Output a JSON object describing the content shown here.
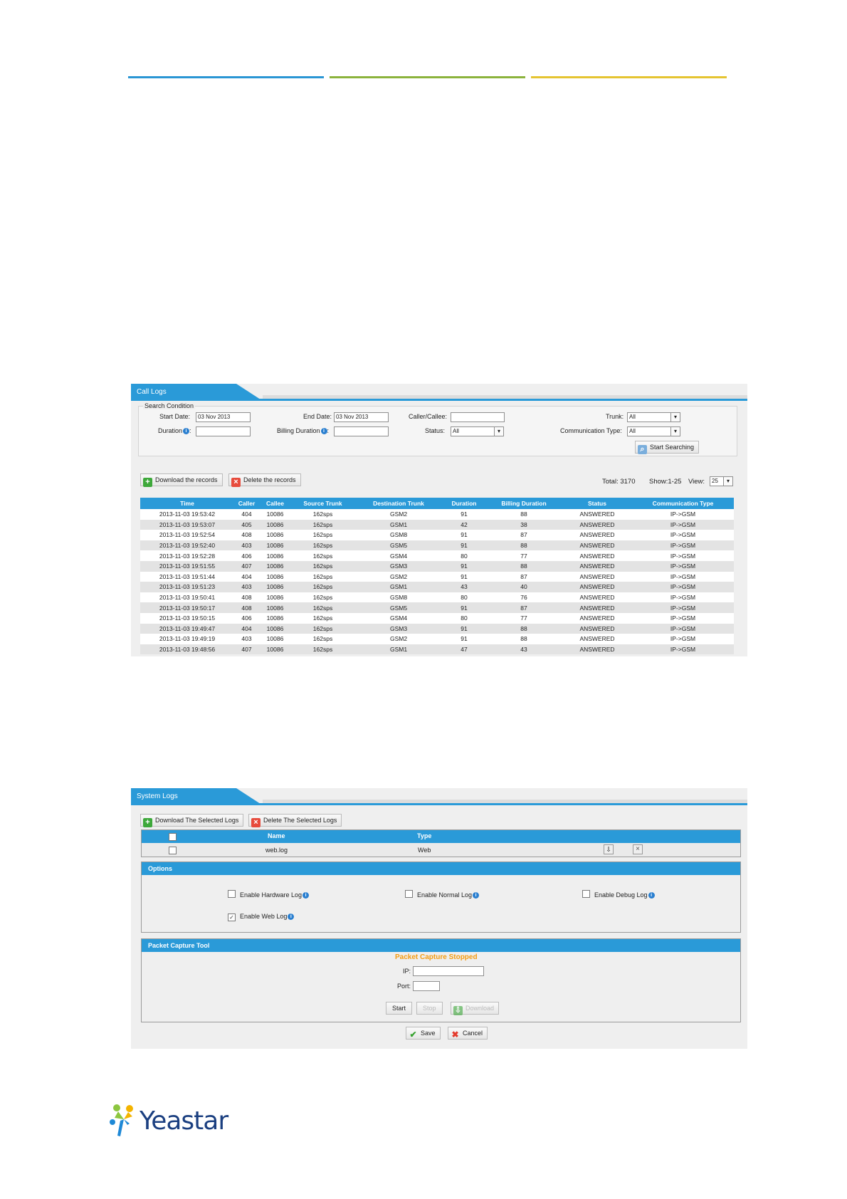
{
  "call_logs": {
    "title": "Call Logs",
    "search": {
      "legend": "Search Condition",
      "start_date_label": "Start Date:",
      "start_date_value": "03 Nov 2013",
      "end_date_label": "End Date:",
      "end_date_value": "03 Nov 2013",
      "caller_callee_label": "Caller/Callee:",
      "caller_callee_value": "",
      "trunk_label": "Trunk:",
      "trunk_value": "All",
      "duration_label": "Duration",
      "duration_value": "",
      "billing_duration_label": "Billing Duration",
      "billing_duration_value": "",
      "status_label": "Status:",
      "status_value": "All",
      "comm_type_label": "Communication Type:",
      "comm_type_value": "All",
      "start_button": "Start Searching"
    },
    "toolbar": {
      "download_label": "Download the records",
      "delete_label": "Delete the records",
      "total": "Total: 3170",
      "show": "Show:1-25",
      "view_label": "View:",
      "view_value": "25"
    },
    "columns": [
      "Time",
      "Caller",
      "Callee",
      "Source Trunk",
      "Destination Trunk",
      "Duration",
      "Billing Duration",
      "Status",
      "Communication Type"
    ],
    "rows": [
      [
        "2013-11-03 19:53:42",
        "404",
        "10086",
        "162sps",
        "GSM2",
        "91",
        "88",
        "ANSWERED",
        "IP->GSM"
      ],
      [
        "2013-11-03 19:53:07",
        "405",
        "10086",
        "162sps",
        "GSM1",
        "42",
        "38",
        "ANSWERED",
        "IP->GSM"
      ],
      [
        "2013-11-03 19:52:54",
        "408",
        "10086",
        "162sps",
        "GSM8",
        "91",
        "87",
        "ANSWERED",
        "IP->GSM"
      ],
      [
        "2013-11-03 19:52:40",
        "403",
        "10086",
        "162sps",
        "GSM5",
        "91",
        "88",
        "ANSWERED",
        "IP->GSM"
      ],
      [
        "2013-11-03 19:52:28",
        "406",
        "10086",
        "162sps",
        "GSM4",
        "80",
        "77",
        "ANSWERED",
        "IP->GSM"
      ],
      [
        "2013-11-03 19:51:55",
        "407",
        "10086",
        "162sps",
        "GSM3",
        "91",
        "88",
        "ANSWERED",
        "IP->GSM"
      ],
      [
        "2013-11-03 19:51:44",
        "404",
        "10086",
        "162sps",
        "GSM2",
        "91",
        "87",
        "ANSWERED",
        "IP->GSM"
      ],
      [
        "2013-11-03 19:51:23",
        "403",
        "10086",
        "162sps",
        "GSM1",
        "43",
        "40",
        "ANSWERED",
        "IP->GSM"
      ],
      [
        "2013-11-03 19:50:41",
        "408",
        "10086",
        "162sps",
        "GSM8",
        "80",
        "76",
        "ANSWERED",
        "IP->GSM"
      ],
      [
        "2013-11-03 19:50:17",
        "408",
        "10086",
        "162sps",
        "GSM5",
        "91",
        "87",
        "ANSWERED",
        "IP->GSM"
      ],
      [
        "2013-11-03 19:50:15",
        "406",
        "10086",
        "162sps",
        "GSM4",
        "80",
        "77",
        "ANSWERED",
        "IP->GSM"
      ],
      [
        "2013-11-03 19:49:47",
        "404",
        "10086",
        "162sps",
        "GSM3",
        "91",
        "88",
        "ANSWERED",
        "IP->GSM"
      ],
      [
        "2013-11-03 19:49:19",
        "403",
        "10086",
        "162sps",
        "GSM2",
        "91",
        "88",
        "ANSWERED",
        "IP->GSM"
      ],
      [
        "2013-11-03 19:48:56",
        "407",
        "10086",
        "162sps",
        "GSM1",
        "47",
        "43",
        "ANSWERED",
        "IP->GSM"
      ]
    ]
  },
  "system_logs": {
    "title": "System Logs",
    "download_selected_label": "Download The Selected Logs",
    "delete_selected_label": "Delete The Selected Logs",
    "columns": [
      "Name",
      "Type"
    ],
    "rows": [
      [
        "web.log",
        "Web"
      ]
    ],
    "options": {
      "header": "Options",
      "enable_hardware_log": "Enable Hardware Log",
      "enable_normal_log": "Enable Normal Log",
      "enable_debug_log": "Enable Debug Log",
      "enable_web_log": "Enable Web Log"
    },
    "packet_capture": {
      "header": "Packet Capture Tool",
      "status": "Packet Capture Stopped",
      "ip_label": "IP:",
      "ip_value": "",
      "port_label": "Port:",
      "port_value": "",
      "start_label": "Start",
      "stop_label": "Stop",
      "download_label": "Download"
    },
    "save_label": "Save",
    "cancel_label": "Cancel"
  },
  "footer": {
    "logo_text": "Yeastar"
  },
  "colors": {
    "accent_blue": "#2a9ad8",
    "bar_green": "#8bb33c",
    "bar_yellow": "#e5c431",
    "status_orange": "#f39c12"
  }
}
